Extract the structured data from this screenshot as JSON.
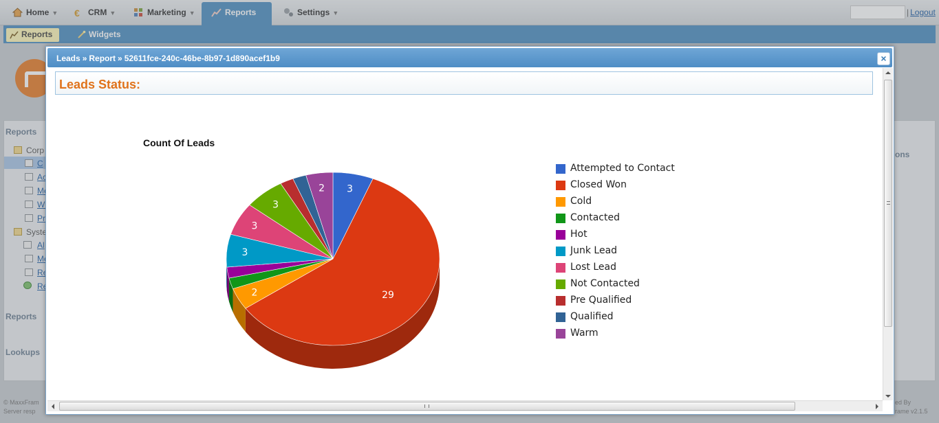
{
  "nav": {
    "tabs": [
      {
        "label": "Home",
        "icon": "home-icon"
      },
      {
        "label": "CRM",
        "icon": "euro-icon"
      },
      {
        "label": "Marketing",
        "icon": "marketing-icon"
      },
      {
        "label": "Reports",
        "icon": "chart-icon",
        "active": true
      },
      {
        "label": "Settings",
        "icon": "gears-icon"
      }
    ],
    "logout": "Logout"
  },
  "subnav": {
    "items": [
      {
        "label": "Reports",
        "icon": "chart-icon",
        "active": true
      },
      {
        "label": "Widgets",
        "icon": "wand-icon"
      }
    ]
  },
  "sidebar": {
    "reports_heading": "Reports",
    "corp_folder": "Corp",
    "items": [
      "C",
      "Ac",
      "Me",
      "Wi",
      "Pr"
    ],
    "system_folder": "Syste",
    "system_items": [
      "Al",
      "Me",
      "Re",
      "Re"
    ],
    "reports_heading2": "Reports",
    "lookups_heading": "Lookups"
  },
  "right_panel": {
    "label": "ons"
  },
  "footer": {
    "left": [
      "© MaxxFram",
      "Server resp"
    ],
    "right": [
      "ed By",
      "rame v2.1.5"
    ]
  },
  "modal": {
    "breadcrumb": [
      "Leads",
      "Report",
      "52611fce-240c-46be-8b97-1d890acef1b9"
    ],
    "close_label": "×",
    "section_title": "Leads Status:"
  },
  "chart_data": {
    "type": "pie",
    "title": "Count Of Leads",
    "categories": [
      "Attempted to Contact",
      "Closed Won",
      "Cold",
      "Contacted",
      "Hot",
      "Junk Lead",
      "Lost Lead",
      "Not Contacted",
      "Pre Qualified",
      "Qualified",
      "Warm"
    ],
    "values": [
      3,
      29,
      2,
      1,
      1,
      3,
      3,
      3,
      1,
      1,
      2
    ],
    "colors": [
      "#3366cc",
      "#dc3912",
      "#ff9900",
      "#109618",
      "#990099",
      "#0099c6",
      "#dd4477",
      "#66aa00",
      "#b82e2e",
      "#316395",
      "#994499"
    ],
    "show_value_labels": true,
    "legend_position": "right",
    "three_d": true
  }
}
